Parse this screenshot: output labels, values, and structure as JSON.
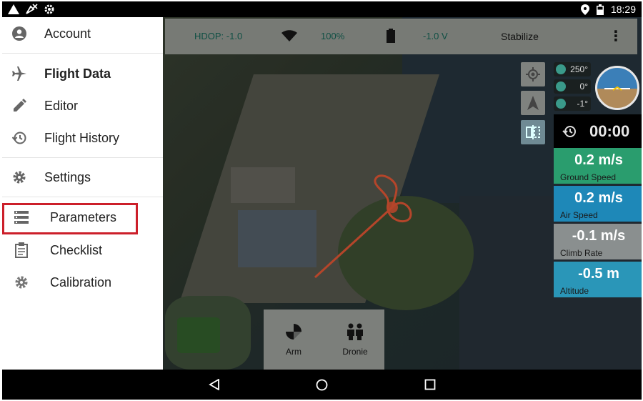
{
  "status_bar": {
    "time": "18:29",
    "icons": [
      "signal-icon",
      "no-gps-icon",
      "settings-gear-icon",
      "location-icon",
      "battery-icon"
    ]
  },
  "telemetry": {
    "hdop": "HDOP: -1.0",
    "signal": "100%",
    "voltage": "-1.0 V",
    "flight_mode": "Stabilize",
    "menu_icon": "overflow-menu-icon"
  },
  "indicators": {
    "yaw": "250°",
    "pitch": "0°",
    "roll": "-1°"
  },
  "timer": "00:00",
  "tiles": [
    {
      "value": "0.2 m/s",
      "label": "Ground Speed",
      "color": "#2a9d6e"
    },
    {
      "value": "0.2 m/s",
      "label": "Air Speed",
      "color": "#1e88b8"
    },
    {
      "value": "-0.1 m/s",
      "label": "Climb Rate",
      "color": "#8a8f8f"
    },
    {
      "value": "-0.5 m",
      "label": "Altitude",
      "color": "#2a96b8"
    }
  ],
  "actions": {
    "arm": "Arm",
    "dronie": "Dronie"
  },
  "drawer": {
    "account": "Account",
    "flight_data": "Flight Data",
    "editor": "Editor",
    "flight_history": "Flight History",
    "settings": "Settings",
    "parameters": "Parameters",
    "checklist": "Checklist",
    "calibration": "Calibration"
  },
  "colors": {
    "highlight": "#cc1f2a",
    "track": "#b5452a"
  }
}
